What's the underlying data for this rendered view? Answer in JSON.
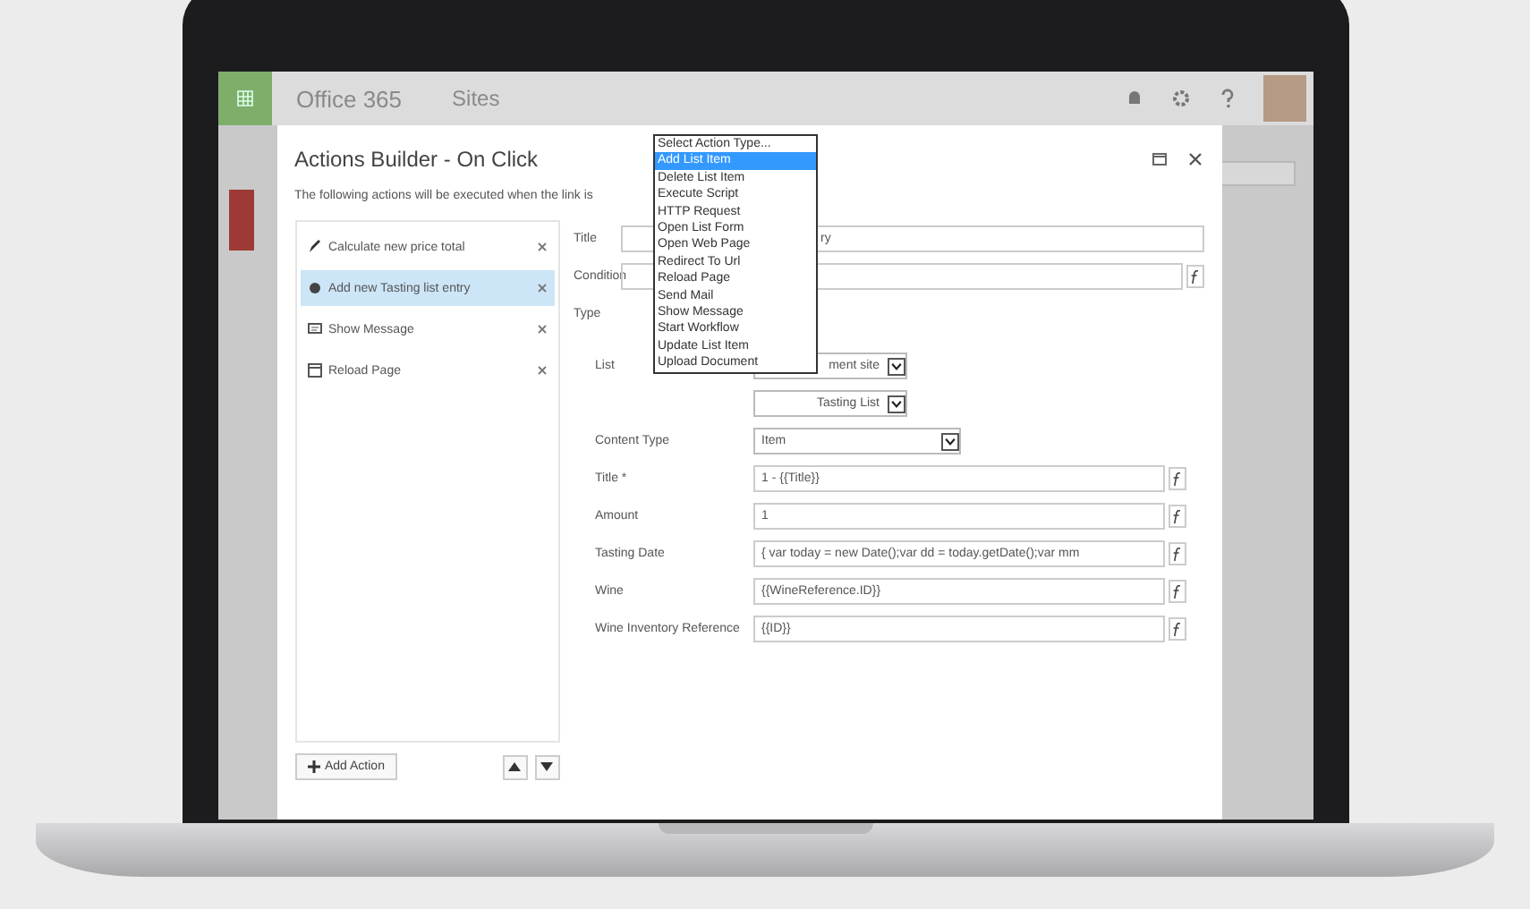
{
  "topbar": {
    "app_name": "Office 365",
    "section": "Sites"
  },
  "dialog": {
    "title": "Actions Builder - On Click",
    "description": "The following actions will be executed when the link is"
  },
  "actions": [
    {
      "label": "Calculate new price total",
      "kind": "script",
      "selected": false
    },
    {
      "label": "Add new Tasting list entry",
      "kind": "add",
      "selected": true
    },
    {
      "label": "Show Message",
      "kind": "message",
      "selected": false
    },
    {
      "label": "Reload Page",
      "kind": "reload",
      "selected": false
    }
  ],
  "add_action": "Add Action",
  "fields": [
    {
      "label": "Title",
      "kind": "text",
      "value": "ry"
    },
    {
      "label": "Condition",
      "kind": "formula"
    },
    {
      "label": "Type",
      "kind": "covered"
    }
  ],
  "type_fields": [
    {
      "label": "List",
      "kind": "select",
      "value": "ment site"
    },
    {
      "kind": "select",
      "value": "Tasting List"
    },
    {
      "label": "Content Type",
      "kind": "select_wide",
      "value": "Item"
    },
    {
      "label": "Title *",
      "kind": "formula",
      "value": "1 - {{Title}}"
    },
    {
      "label": "Amount",
      "kind": "formula",
      "value": "1"
    },
    {
      "label": "Tasting Date",
      "kind": "formula",
      "value": "{ var today = new Date();var dd = today.getDate();var mm"
    },
    {
      "label": "Wine",
      "kind": "formula",
      "value": "{{WineReference.ID}}"
    },
    {
      "label": "Wine Inventory Reference",
      "kind": "formula",
      "value": "{{ID}}"
    }
  ],
  "type_dropdown": [
    {
      "label": "Select Action Type...",
      "selected": false
    },
    {
      "label": "Add List Item",
      "selected": true
    },
    {
      "label": "Delete List Item",
      "selected": false
    },
    {
      "label": "Execute Script",
      "selected": false
    },
    {
      "label": "HTTP Request",
      "selected": false
    },
    {
      "label": "Open List Form",
      "selected": false
    },
    {
      "label": "Open Web Page",
      "selected": false
    },
    {
      "label": "Redirect To Url",
      "selected": false
    },
    {
      "label": "Reload Page",
      "selected": false
    },
    {
      "label": "Send Mail",
      "selected": false
    },
    {
      "label": "Show Message",
      "selected": false
    },
    {
      "label": "Start Workflow",
      "selected": false
    },
    {
      "label": "Update List Item",
      "selected": false
    },
    {
      "label": "Upload Document",
      "selected": false
    }
  ]
}
